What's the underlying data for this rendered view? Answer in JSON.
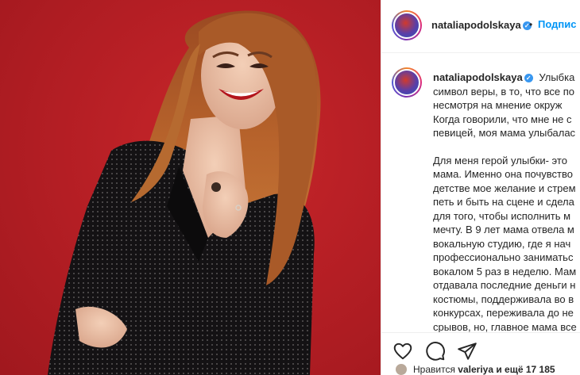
{
  "post": {
    "username": "nataliapodolskaya",
    "follow_label": "Подпис",
    "follow_separator": "•",
    "verified_icon": "verified-badge-icon",
    "caption_lines": [
      "Улыбка",
      "символ веры, в то, что все по",
      "несмотря на мнение окруж",
      "Когда говорили, что мне не с",
      "певицей, моя мама улыбалас",
      "",
      "Для меня герой улыбки- это",
      "мама. Именно она почувство",
      "детстве мое желание и стрем",
      "петь и быть на сцене и сдела",
      "для того, чтобы исполнить м",
      "мечту. В 9 лет мама отвела м",
      "вокальную студию, где я нач",
      "профессионально заниматьс",
      "вокалом 5 раз в неделю. Мам",
      "отдавала последние деньги н",
      "костюмы, поддерживала во в",
      "конкурсах, переживала до не",
      "срывов, но, главное мама все"
    ],
    "likes_text_prefix": "Нравится ",
    "likes_user": "valeriya",
    "likes_text_suffix": " и ещё 17 185"
  },
  "icons": {
    "like": "heart-icon",
    "comment": "comment-icon",
    "share": "share-icon"
  },
  "colors": {
    "background_red": "#b71f25",
    "link_blue": "#0095f6",
    "verified_blue": "#3897f0"
  }
}
